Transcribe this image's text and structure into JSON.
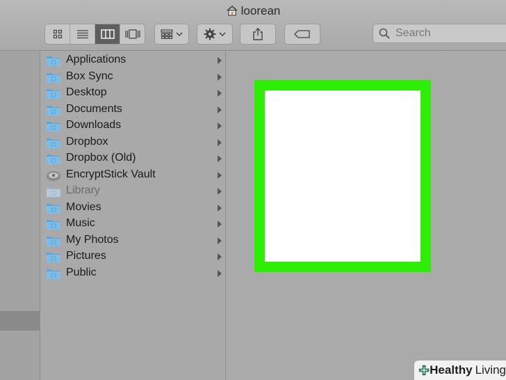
{
  "window": {
    "title": "loorean"
  },
  "toolbar": {
    "view_buttons": [
      "icon-view",
      "list-view",
      "column-view",
      "cover-flow-view"
    ],
    "active_view": "column-view",
    "search_placeholder": "Search"
  },
  "column": {
    "items": [
      {
        "label": "Applications",
        "icon": "applications-folder-icon"
      },
      {
        "label": "Box Sync",
        "icon": "box-sync-folder-icon"
      },
      {
        "label": "Desktop",
        "icon": "desktop-folder-icon"
      },
      {
        "label": "Documents",
        "icon": "documents-folder-icon"
      },
      {
        "label": "Downloads",
        "icon": "downloads-folder-icon"
      },
      {
        "label": "Dropbox",
        "icon": "dropbox-folder-icon"
      },
      {
        "label": "Dropbox (Old)",
        "icon": "dropbox-folder-icon"
      },
      {
        "label": "EncryptStick Vault",
        "icon": "vault-icon"
      },
      {
        "label": "Library",
        "icon": "library-folder-icon"
      },
      {
        "label": "Movies",
        "icon": "movies-folder-icon"
      },
      {
        "label": "Music",
        "icon": "music-folder-icon"
      },
      {
        "label": "My Photos",
        "icon": "folder-icon"
      },
      {
        "label": "Pictures",
        "icon": "pictures-folder-icon"
      },
      {
        "label": "Public",
        "icon": "public-folder-icon"
      }
    ]
  },
  "highlight": {
    "color": "#2eee06"
  },
  "watermark": {
    "part1": "Healthy",
    "part2": "Living"
  }
}
